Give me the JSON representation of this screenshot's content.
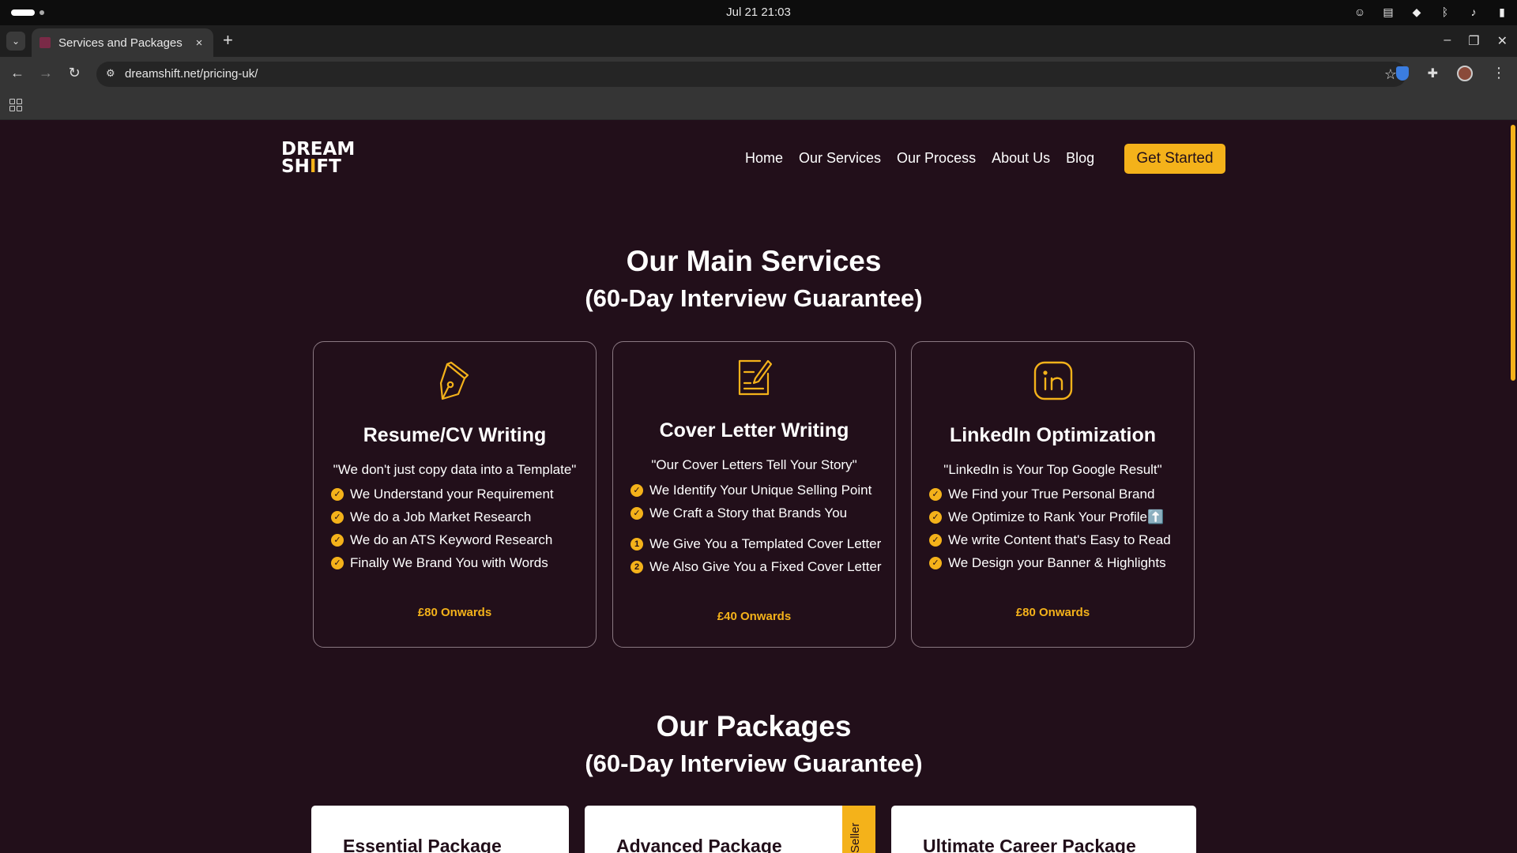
{
  "os": {
    "clock": "Jul 21  21:03"
  },
  "browser": {
    "tab_title": "Services and Packages (R",
    "url": "dreamshift.net/pricing-uk/"
  },
  "site": {
    "logo_line1": "DREAM",
    "logo_line2_pre": "SH",
    "logo_line2_accent": "I",
    "logo_line2_post": "FT",
    "nav": [
      "Home",
      "Our Services",
      "Our Process",
      "About Us",
      "Blog"
    ],
    "cta": "Get Started"
  },
  "services": {
    "title": "Our Main Services",
    "subtitle": "(60-Day Interview Guarantee)",
    "cards": [
      {
        "icon": "pen-nib-icon",
        "title": "Resume/CV Writing",
        "quote": "\"We don't just copy data into a Template\"",
        "items": [
          "We Understand your Requirement",
          "We do a Job Market Research",
          "We do an ATS Keyword Research",
          "Finally We Brand You with Words"
        ],
        "price": "£80 Onwards"
      },
      {
        "icon": "document-edit-icon",
        "title": "Cover Letter Writing",
        "quote": "\"Our Cover Letters Tell Your Story\"",
        "items": [
          "We Identify Your Unique Selling Point",
          "We Craft a Story that Brands You",
          "We Give You a Templated Cover Letter",
          "We Also Give You a Fixed Cover Letter"
        ],
        "markers": [
          "✓",
          "✓",
          "1",
          "2"
        ],
        "price": "£40 Onwards"
      },
      {
        "icon": "linkedin-icon",
        "title": "LinkedIn Optimization",
        "quote": "\"LinkedIn is Your Top Google Result\"",
        "items": [
          "We Find your True Personal Brand",
          "We Optimize to Rank Your Profile⬆️",
          "We write Content that's Easy to Read",
          "We Design your Banner & Highlights"
        ],
        "price": "£80 Onwards"
      }
    ]
  },
  "packages": {
    "title": "Our Packages",
    "subtitle": "(60-Day Interview Guarantee)",
    "items": [
      "Essential Package",
      "Advanced Package",
      "Ultimate Career Package"
    ],
    "ribbon": "Seller"
  },
  "colors": {
    "background": "#220f1a",
    "accent": "#f4b21a"
  }
}
